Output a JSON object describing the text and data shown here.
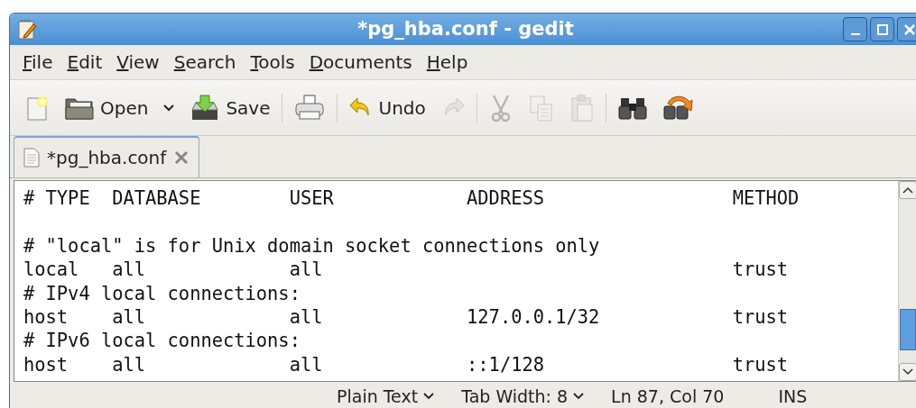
{
  "window": {
    "title": "*pg_hba.conf - gedit"
  },
  "menu": [
    "File",
    "Edit",
    "View",
    "Search",
    "Tools",
    "Documents",
    "Help"
  ],
  "toolbar": [
    {
      "kind": "new",
      "disabled": false
    },
    {
      "kind": "open",
      "label": "Open",
      "disabled": false
    },
    {
      "kind": "dropdown",
      "disabled": false
    },
    {
      "kind": "save",
      "label": "Save",
      "disabled": false
    },
    {
      "kind": "separator"
    },
    {
      "kind": "print",
      "disabled": false
    },
    {
      "kind": "separator"
    },
    {
      "kind": "undo",
      "label": "Undo",
      "disabled": false
    },
    {
      "kind": "redo",
      "disabled": true
    },
    {
      "kind": "separator"
    },
    {
      "kind": "cut",
      "disabled": true
    },
    {
      "kind": "copy",
      "disabled": true
    },
    {
      "kind": "paste",
      "disabled": true
    },
    {
      "kind": "separator"
    },
    {
      "kind": "find",
      "disabled": false
    },
    {
      "kind": "replace",
      "disabled": false
    }
  ],
  "tabs": [
    {
      "label": "*pg_hba.conf",
      "selected": true
    }
  ],
  "editor": {
    "lines": [
      {
        "kind": "code",
        "text": "# TYPE  DATABASE        USER            ADDRESS                 METHOD"
      },
      {
        "kind": "blank"
      },
      {
        "kind": "code",
        "text": "# \"local\" is for Unix domain socket connections only"
      },
      {
        "kind": "code",
        "text": "local   all             all                                     trust"
      },
      {
        "kind": "code",
        "text": "# IPv4 local connections:"
      },
      {
        "kind": "code",
        "text": "host    all             all             127.0.0.1/32            trust"
      },
      {
        "kind": "code",
        "text": "# IPv6 local connections:"
      },
      {
        "kind": "code",
        "text": "host    all             all             ::1/128                 trust"
      }
    ]
  },
  "status_bar": [
    {
      "kind": "dropdown",
      "text": "Plain Text"
    },
    {
      "kind": "dropdown",
      "text": "Tab Width:  8"
    },
    {
      "kind": "text",
      "text": "Ln 87, Col 70"
    },
    {
      "kind": "text",
      "text": "INS"
    }
  ]
}
